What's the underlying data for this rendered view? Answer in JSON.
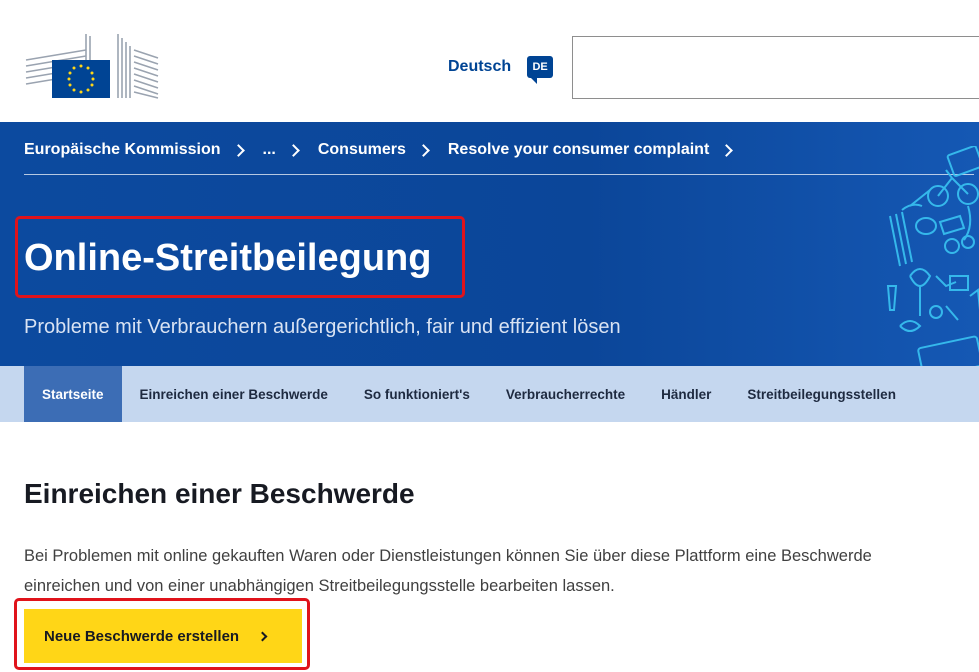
{
  "header": {
    "logo_name": "european-commission-logo",
    "language_label": "Deutsch",
    "language_code": "DE",
    "search_placeholder": ""
  },
  "breadcrumb": [
    {
      "label": "Europäische Kommission"
    },
    {
      "label": "..."
    },
    {
      "label": "Consumers"
    },
    {
      "label": "Resolve your consumer complaint"
    }
  ],
  "hero": {
    "title": "Online-Streitbeilegung",
    "subtitle": "Probleme mit Verbrauchern außergerichtlich, fair und effizient lösen"
  },
  "nav": {
    "items": [
      {
        "label": "Startseite"
      },
      {
        "label": "Einreichen einer Beschwerde"
      },
      {
        "label": "So funktioniert's"
      },
      {
        "label": "Verbraucherrechte"
      },
      {
        "label": "Händler"
      },
      {
        "label": "Streitbeilegungsstellen"
      }
    ],
    "active_index": 0
  },
  "main": {
    "heading": "Einreichen einer Beschwerde",
    "text": "Bei Problemen mit online gekauften Waren oder Dienstleistungen können Sie über diese Plattform eine Beschwerde einreichen und von einer unabhängigen Streitbeilegungsstelle bearbeiten lassen.",
    "cta_label": "Neue Beschwerde erstellen"
  },
  "colors": {
    "brand_blue": "#004494",
    "hero_blue": "#0b4699",
    "nav_bg": "#c5d7ef",
    "nav_active": "#3c6db5",
    "cta_yellow": "#ffd617",
    "highlight_red": "#e0131b"
  }
}
